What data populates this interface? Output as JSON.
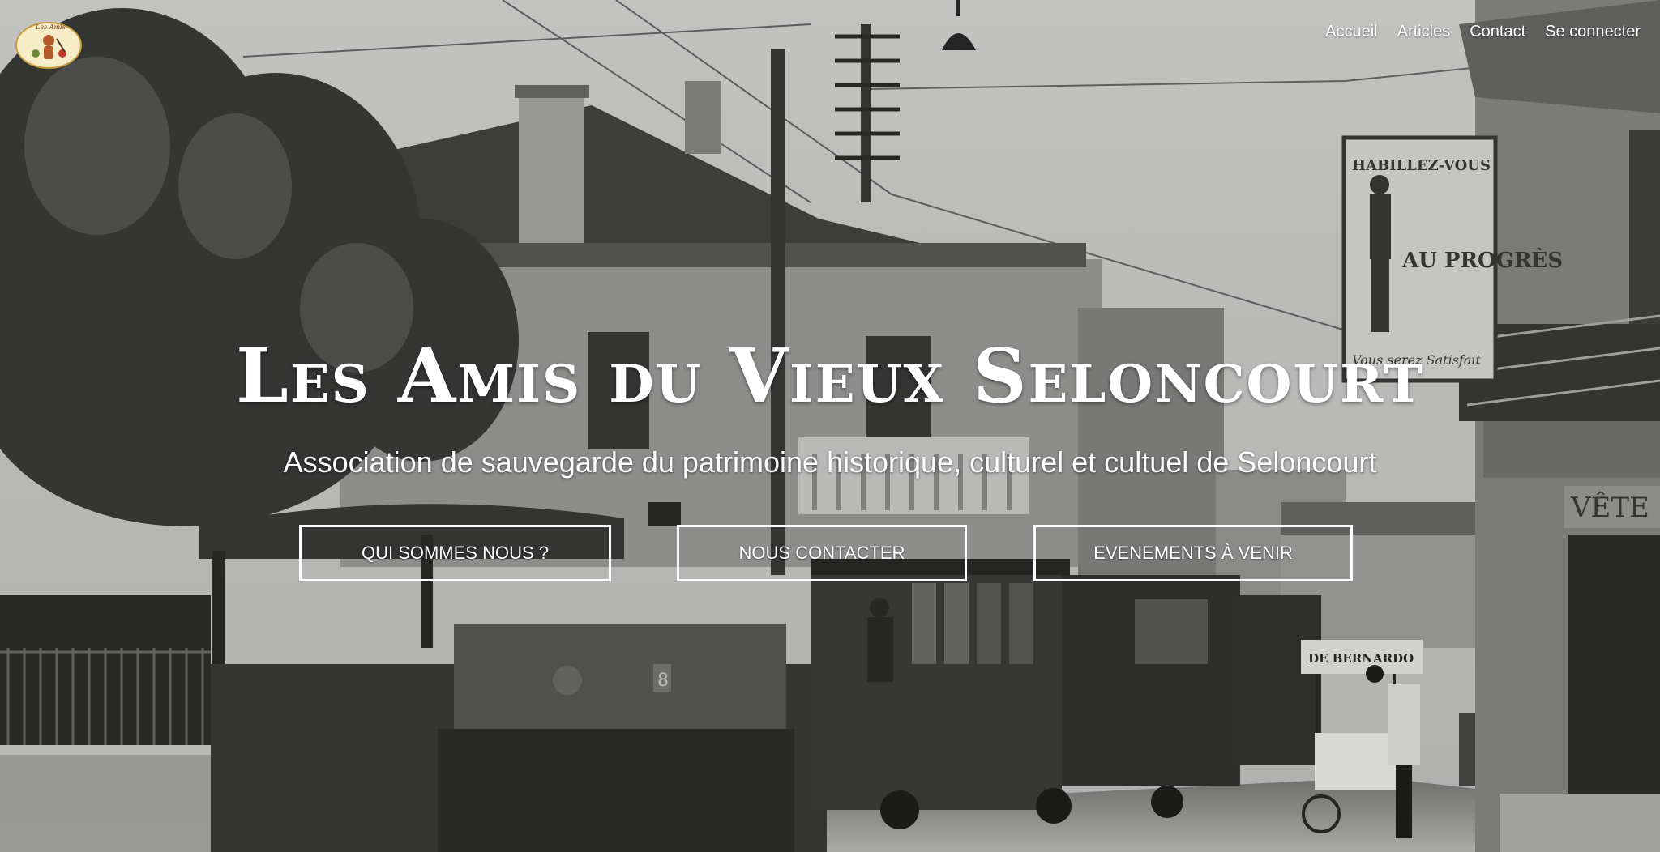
{
  "logo": {
    "caption": "Les Amis du Vieux Seloncourt"
  },
  "nav": {
    "items": [
      {
        "label": "Accueil"
      },
      {
        "label": "Articles"
      },
      {
        "label": "Contact"
      },
      {
        "label": "Se connecter"
      }
    ]
  },
  "hero": {
    "title": "Les Amis du Vieux Seloncourt",
    "subtitle": "Association de sauvegarde du patrimoine historique, culturel et cultuel de Seloncourt",
    "buttons": [
      {
        "label": "QUI SOMMES NOUS ?"
      },
      {
        "label": "NOUS CONTACTER"
      },
      {
        "label": "EVENEMENTS À VENIR"
      }
    ]
  },
  "photo": {
    "sign_top": "HABILLEZ-VOUS",
    "sign_main": "AU PROGRÈS",
    "sign_bottom": "Vous serez Satisfait",
    "cart_sign": "DE BERNARDO",
    "shop_sign": "VÊTE",
    "loco_number": "8"
  },
  "colors": {
    "text": "#ffffff",
    "button_border": "#ffffff"
  }
}
